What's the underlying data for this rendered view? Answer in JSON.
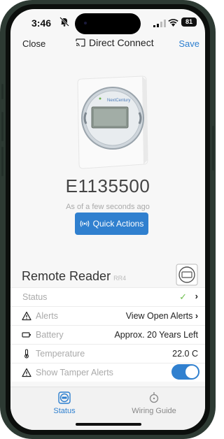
{
  "status_bar": {
    "time": "3:46",
    "battery": "81",
    "icons": [
      "bell-slash-icon",
      "signal-icon",
      "wifi-icon",
      "battery-icon"
    ]
  },
  "nav": {
    "close_label": "Close",
    "title": "Direct Connect",
    "title_icon": "cast-icon",
    "save_label": "Save"
  },
  "device": {
    "image_label": "NextCentury",
    "id": "E1135500",
    "updated": "As of a few seconds ago",
    "quick_actions_label": "Quick Actions"
  },
  "reader": {
    "title": "Remote Reader",
    "model": "RR4"
  },
  "rows": {
    "status_label": "Status",
    "alerts_label": "Alerts",
    "alerts_value": "View Open Alerts",
    "battery_label": "Battery",
    "battery_value": "Approx. 20 Years Left",
    "temperature_label": "Temperature",
    "temperature_value": "22.0 C",
    "tamper_label": "Show Tamper Alerts",
    "tamper_enabled": true
  },
  "tabs": {
    "status_label": "Status",
    "wiring_label": "Wiring Guide"
  },
  "colors": {
    "accent": "#3080cf",
    "check": "#6fbf4f",
    "frame": "#2d3a33"
  }
}
